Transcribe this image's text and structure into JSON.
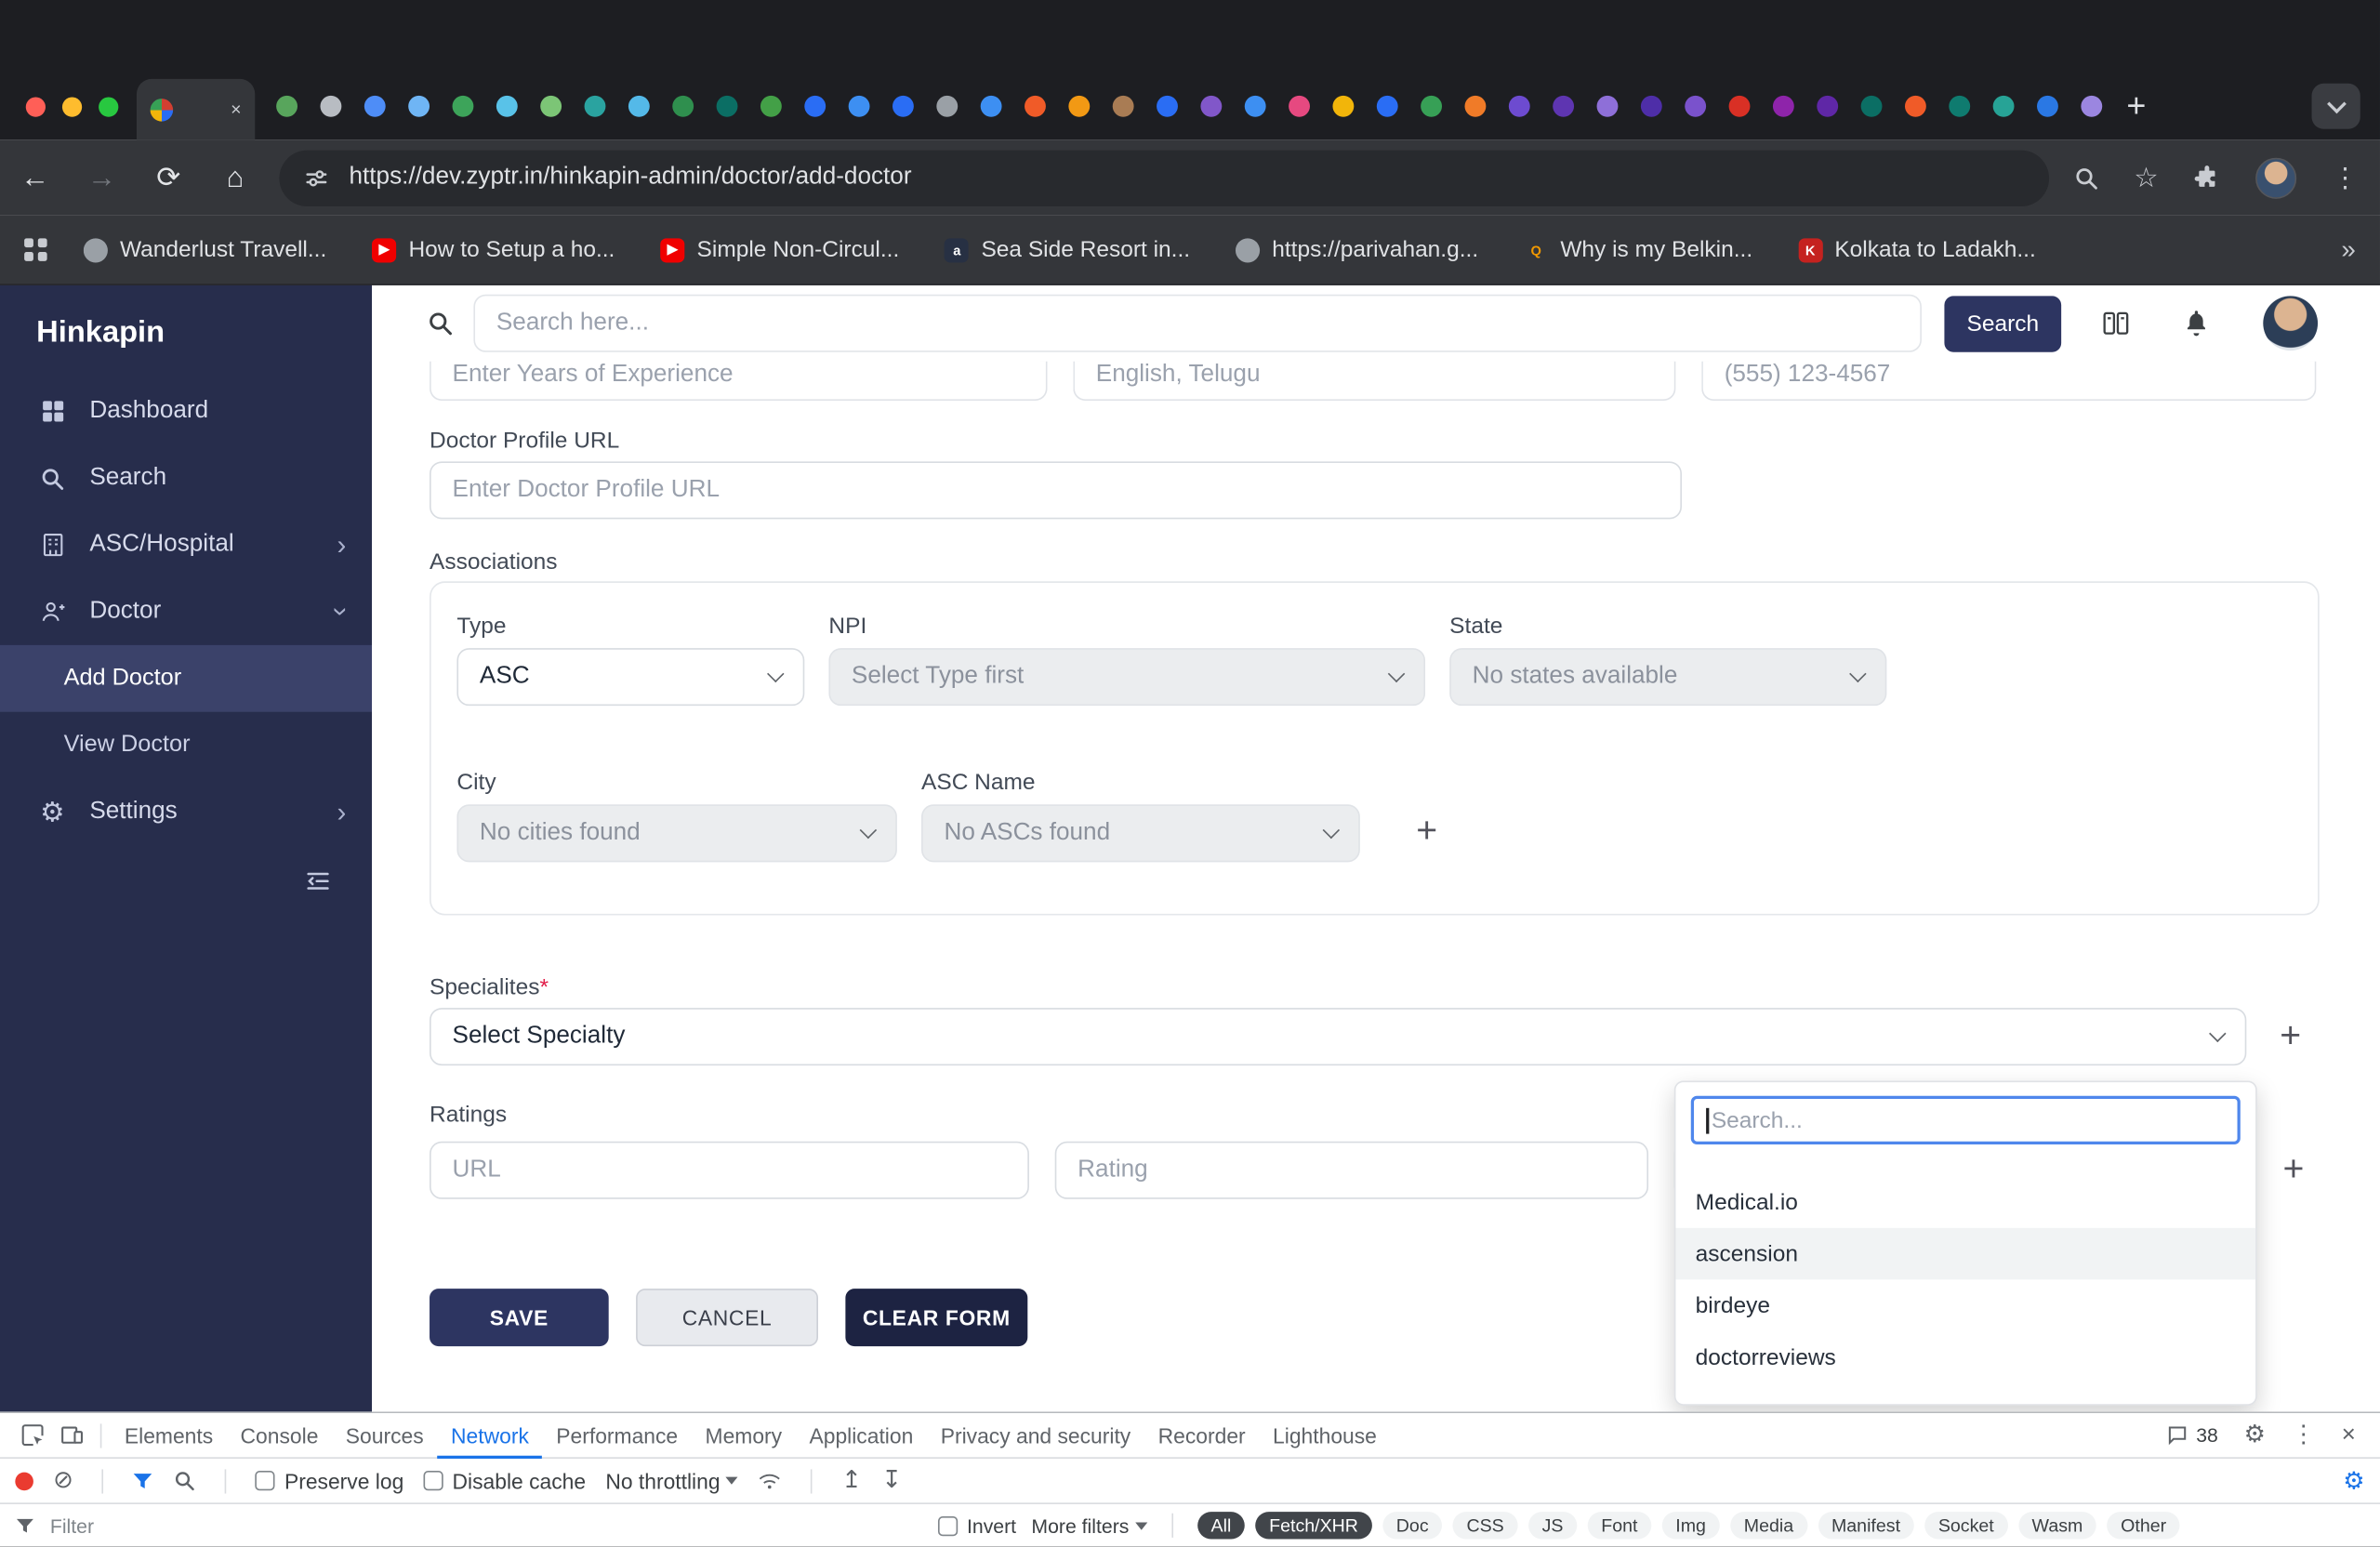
{
  "window": {
    "traffic_lights": [
      "#ff5f57",
      "#febc2e",
      "#28c840"
    ],
    "active_tab": {
      "close_glyph": "×"
    },
    "tab_favicons": [
      "#58a55c",
      "#b8bcc2",
      "#4e8df7",
      "#6fb5f5",
      "#3da45a",
      "#59c2e8",
      "#7cc576",
      "#2aa3a0",
      "#54b9e8",
      "#2f8f4e",
      "#0b6e64",
      "#43a047",
      "#2a6df4",
      "#3d8ff2",
      "#2a6df4",
      "#9aa0a6",
      "#3d8ff2",
      "#f05b28",
      "#f29914",
      "#a97c54",
      "#2a6df4",
      "#8157c9",
      "#3d8ff2",
      "#e64980",
      "#f2b50a",
      "#2a6df4",
      "#37a056",
      "#f07b28",
      "#6d4bd0",
      "#5e35b1",
      "#8e6fd8",
      "#4e2ea8",
      "#7a52cc",
      "#d93025",
      "#8e24aa",
      "#5f27a6",
      "#0b6e64",
      "#f05b28",
      "#0f7b6f",
      "#27a396",
      "#2a78e4",
      "#9b86e0"
    ],
    "new_tab_glyph": "+",
    "toolbar": {
      "back_glyph": "←",
      "forward_glyph": "→",
      "reload_glyph": "⟳",
      "home_glyph": "⌂",
      "url": "https://dev.zyptr.in/hinkapin-admin/doctor/add-doctor",
      "star_glyph": "☆",
      "menu_glyph": "⋮"
    },
    "bookmarks": [
      {
        "label": "Wanderlust Travell...",
        "round": true
      },
      {
        "label": "How to Setup a ho...",
        "glyph": "▶",
        "bg": "#f00000",
        "fg": "#ffffff"
      },
      {
        "label": "Simple Non-Circul...",
        "glyph": "▶",
        "bg": "#f00000",
        "fg": "#ffffff"
      },
      {
        "label": "Sea Side Resort in...",
        "glyph": "a",
        "bg": "#273043",
        "fg": "#ffffff"
      },
      {
        "label": "https://parivahan.g...",
        "round": true
      },
      {
        "label": "Why is my Belkin...",
        "glyph": "Q",
        "fg": "#f29900"
      },
      {
        "label": "Kolkata to Ladakh...",
        "glyph": "K",
        "bg": "#c5221f",
        "fg": "#ffffff"
      }
    ],
    "bookmarks_overflow_glyph": "»"
  },
  "app": {
    "brand": "Hinkapin",
    "sidebar": {
      "chevron_glyph": "›",
      "items": [
        {
          "label": "Dashboard"
        },
        {
          "label": "Search"
        },
        {
          "label": "ASC/Hospital"
        },
        {
          "label": "Doctor"
        },
        {
          "label": "Add Doctor"
        },
        {
          "label": "View Doctor"
        },
        {
          "label": "Settings"
        }
      ]
    },
    "header": {
      "search_placeholder": "Search here...",
      "search_button": "Search"
    },
    "form": {
      "add_glyph": "+",
      "cut_row": {
        "experience_placeholder": "Enter Years of Experience",
        "languages_value": "English, Telugu",
        "phone_placeholder": "(555) 123-4567"
      },
      "profile_url": {
        "label": "Doctor Profile URL",
        "placeholder": "Enter Doctor Profile URL"
      },
      "associations": {
        "title": "Associations",
        "type": {
          "label": "Type",
          "value": "ASC"
        },
        "npi": {
          "label": "NPI",
          "value": "Select Type first"
        },
        "state": {
          "label": "State",
          "value": "No states available"
        },
        "city": {
          "label": "City",
          "value": "No cities found"
        },
        "asc_name": {
          "label": "ASC Name",
          "value": "No ASCs found"
        }
      },
      "specialties": {
        "label": "Specialites",
        "required_mark": "*",
        "value": "Select Specialty"
      },
      "ratings": {
        "label": "Ratings",
        "url_placeholder": "URL",
        "rating_placeholder": "Rating"
      },
      "review_dropdown": {
        "search_placeholder": "Search...",
        "options": [
          {
            "label": "Medical.io"
          },
          {
            "label": "ascension",
            "highlighted": true
          },
          {
            "label": "birdeye"
          },
          {
            "label": "doctorreviews"
          }
        ]
      },
      "actions": {
        "save": "SAVE",
        "cancel": "CANCEL",
        "clear": "CLEAR FORM"
      }
    }
  },
  "devtools": {
    "tabs": [
      {
        "label": "Elements"
      },
      {
        "label": "Console"
      },
      {
        "label": "Sources"
      },
      {
        "label": "Network",
        "active": true
      },
      {
        "label": "Performance"
      },
      {
        "label": "Memory"
      },
      {
        "label": "Application"
      },
      {
        "label": "Privacy and security"
      },
      {
        "label": "Recorder"
      },
      {
        "label": "Lighthouse"
      }
    ],
    "messages_badge": "38",
    "icons": {
      "clear_glyph": "⊘",
      "import_glyph": "↥",
      "export_glyph": "↧",
      "settings_glyph": "⚙",
      "overflow_glyph": "⋮",
      "close_glyph": "×",
      "net_settings_glyph": "⚙"
    },
    "network_bar": {
      "preserve_log": "Preserve log",
      "disable_cache": "Disable cache",
      "throttling": "No throttling"
    },
    "filter_bar": {
      "filter_placeholder": "Filter",
      "invert": "Invert",
      "more_filters": "More filters",
      "chips": [
        {
          "label": "All",
          "selected": true
        },
        {
          "label": "Fetch/XHR",
          "selected": true
        },
        {
          "label": "Doc"
        },
        {
          "label": "CSS"
        },
        {
          "label": "JS"
        },
        {
          "label": "Font"
        },
        {
          "label": "Img"
        },
        {
          "label": "Media"
        },
        {
          "label": "Manifest"
        },
        {
          "label": "Socket"
        },
        {
          "label": "Wasm"
        },
        {
          "label": "Other"
        }
      ]
    }
  }
}
